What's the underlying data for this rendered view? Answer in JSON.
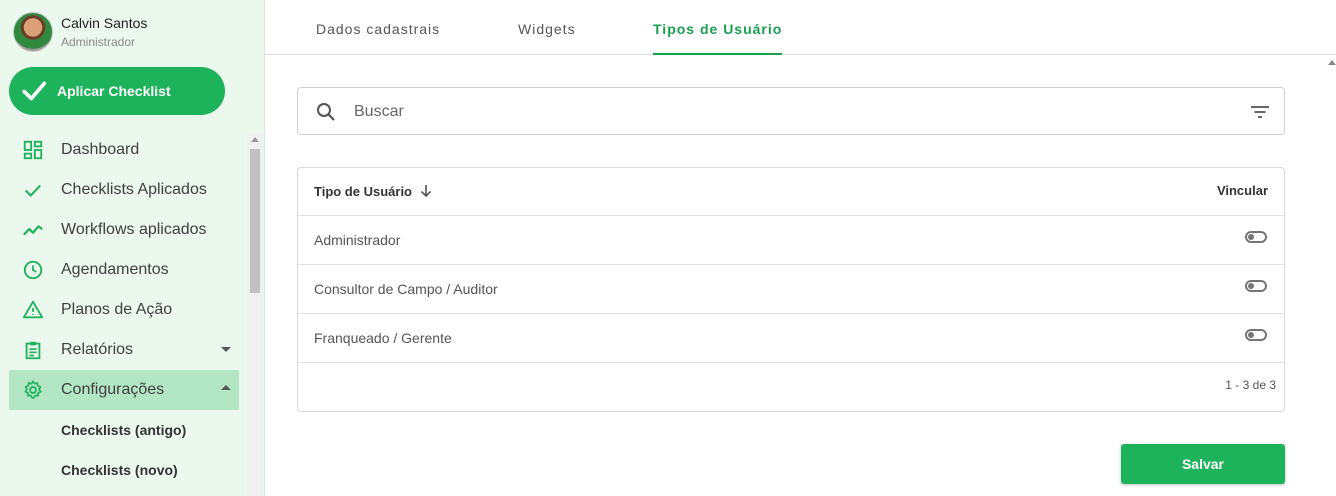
{
  "user": {
    "name": "Calvin Santos",
    "role": "Administrador"
  },
  "sidebar": {
    "apply_button": "Aplicar Checklist",
    "items": [
      {
        "label": "Dashboard",
        "icon": "dashboard-icon"
      },
      {
        "label": "Checklists Aplicados",
        "icon": "check-icon"
      },
      {
        "label": "Workflows aplicados",
        "icon": "trending-icon"
      },
      {
        "label": "Agendamentos",
        "icon": "clock-icon"
      },
      {
        "label": "Planos de Ação",
        "icon": "warning-icon"
      },
      {
        "label": "Relatórios",
        "icon": "clipboard-icon"
      },
      {
        "label": "Configurações",
        "icon": "gear-icon"
      }
    ],
    "sub_items": [
      {
        "label": "Checklists (antigo)"
      },
      {
        "label": "Checklists (novo)"
      }
    ]
  },
  "tabs": [
    {
      "label": "Dados cadastrais"
    },
    {
      "label": "Widgets"
    },
    {
      "label": "Tipos de Usuário",
      "active": true
    }
  ],
  "search": {
    "placeholder": "Buscar",
    "value": ""
  },
  "table": {
    "col_name": "Tipo de Usuário",
    "col_link": "Vincular",
    "rows": [
      {
        "name": "Administrador",
        "linked": false
      },
      {
        "name": "Consultor de Campo / Auditor",
        "linked": false
      },
      {
        "name": "Franqueado / Gerente",
        "linked": false
      }
    ],
    "pagination": "1 - 3 de 3"
  },
  "save_button": "Salvar",
  "colors": {
    "accent": "#1db35b",
    "sidebar_bg": "#eaf8ee",
    "active_item": "#b2e6c5",
    "tab_active": "#1a9f4f"
  }
}
